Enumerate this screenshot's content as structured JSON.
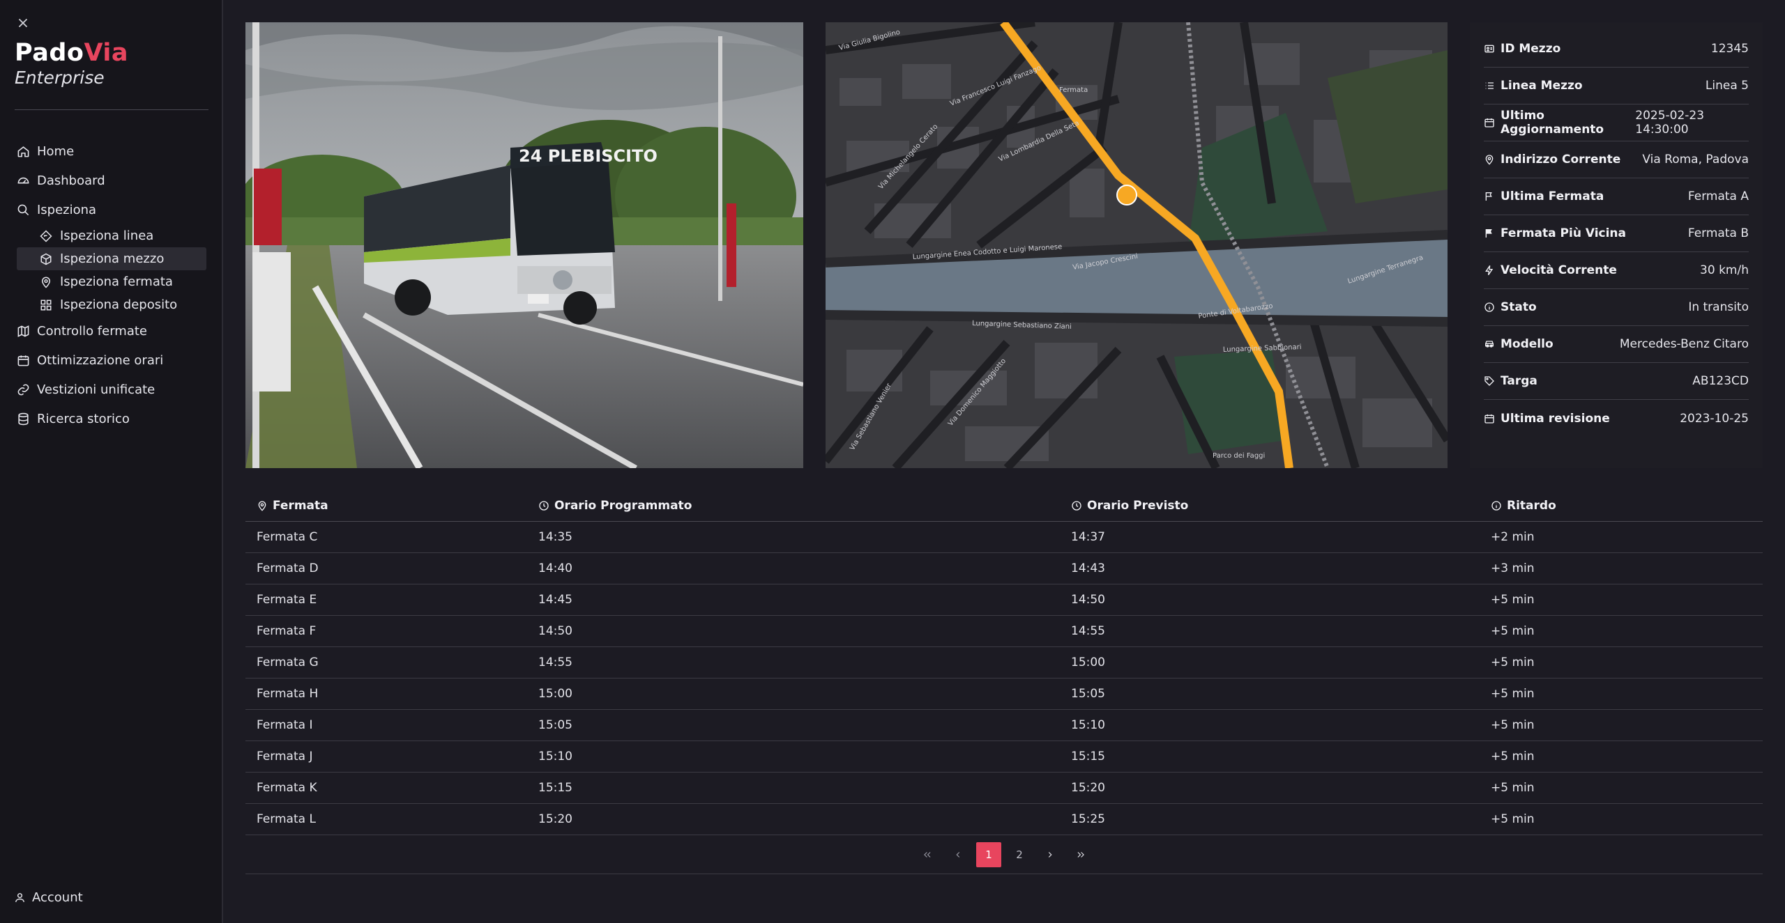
{
  "brand": {
    "name_a": "Pado",
    "name_b": "Via",
    "subtitle": "Enterprise"
  },
  "nav": {
    "home": "Home",
    "dashboard": "Dashboard",
    "ispeziona": "Ispeziona",
    "ispeziona_linea": "Ispeziona linea",
    "ispeziona_mezzo": "Ispeziona mezzo",
    "ispeziona_fermata": "Ispeziona fermata",
    "ispeziona_deposito": "Ispeziona deposito",
    "controllo_fermate": "Controllo fermate",
    "ottimizzazione_orari": "Ottimizzazione orari",
    "vestizioni_unificate": "Vestizioni unificate",
    "ricerca_storico": "Ricerca storico",
    "account": "Account"
  },
  "photo": {
    "destination_sign": "24 PLEBISCITO"
  },
  "map": {
    "streets": [
      "Via Giulia Bigolino",
      "Via Francesco Luigi Fanzago",
      "Via Michelangelo Cerato",
      "Via Lombardia Della Seta",
      "Lungargine Enea Codotto e Luigi Maronese",
      "Via Jacopo Crescini",
      "Lungargine Sebastiano Ziani",
      "Lungargine Terranegra",
      "Lungargine Sabbionari",
      "Via Domenico Maggiotto",
      "Via Sebastiano Venier",
      "Fermata",
      "Ponte di Voltabarozzo",
      "Parco dei Faggi"
    ]
  },
  "details": [
    {
      "label": "ID Mezzo",
      "value": "12345",
      "icon": "id-card-icon"
    },
    {
      "label": "Linea Mezzo",
      "value": "Linea 5",
      "icon": "list-icon"
    },
    {
      "label": "Ultimo Aggiornamento",
      "value": "2025-02-23 14:30:00",
      "icon": "calendar-icon"
    },
    {
      "label": "Indirizzo Corrente",
      "value": "Via Roma, Padova",
      "icon": "map-pin-icon"
    },
    {
      "label": "Ultima Fermata",
      "value": "Fermata A",
      "icon": "flag-outline-icon"
    },
    {
      "label": "Fermata Più Vicina",
      "value": "Fermata B",
      "icon": "flag-filled-icon"
    },
    {
      "label": "Velocità Corrente",
      "value": "30 km/h",
      "icon": "bolt-icon"
    },
    {
      "label": "Stato",
      "value": "In transito",
      "icon": "info-icon"
    },
    {
      "label": "Modello",
      "value": "Mercedes-Benz Citaro",
      "icon": "car-icon"
    },
    {
      "label": "Targa",
      "value": "AB123CD",
      "icon": "tag-icon"
    },
    {
      "label": "Ultima revisione",
      "value": "2023-10-25",
      "icon": "calendar-icon"
    }
  ],
  "table": {
    "headers": [
      "Fermata",
      "Orario Programmato",
      "Orario Previsto",
      "Ritardo"
    ],
    "rows": [
      [
        "Fermata C",
        "14:35",
        "14:37",
        "+2 min"
      ],
      [
        "Fermata D",
        "14:40",
        "14:43",
        "+3 min"
      ],
      [
        "Fermata E",
        "14:45",
        "14:50",
        "+5 min"
      ],
      [
        "Fermata F",
        "14:50",
        "14:55",
        "+5 min"
      ],
      [
        "Fermata G",
        "14:55",
        "15:00",
        "+5 min"
      ],
      [
        "Fermata H",
        "15:00",
        "15:05",
        "+5 min"
      ],
      [
        "Fermata I",
        "15:05",
        "15:10",
        "+5 min"
      ],
      [
        "Fermata J",
        "15:10",
        "15:15",
        "+5 min"
      ],
      [
        "Fermata K",
        "15:15",
        "15:20",
        "+5 min"
      ],
      [
        "Fermata L",
        "15:20",
        "15:25",
        "+5 min"
      ]
    ]
  },
  "pagination": {
    "pages": [
      "1",
      "2"
    ],
    "current": "1"
  },
  "colors": {
    "accent": "#e8455e",
    "route": "#f7a823",
    "background": "#1c1b23",
    "sidebar": "#16151b"
  }
}
